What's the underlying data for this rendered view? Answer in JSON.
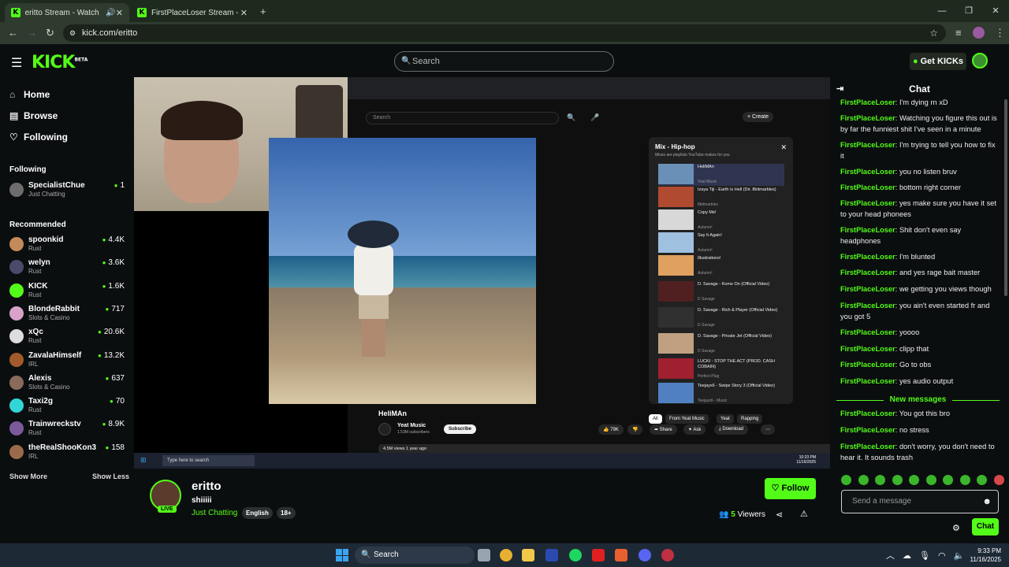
{
  "browser": {
    "tabs": [
      {
        "label": "eritto Stream - Watch Live o",
        "active": true
      },
      {
        "label": "FirstPlaceLoser Stream - Watch",
        "active": false
      }
    ],
    "url": "kick.com/eritto"
  },
  "header": {
    "logo": "KICK",
    "logo_beta": "BETA",
    "search_placeholder": "Search",
    "get_kicks": "Get KICKs"
  },
  "sidebar": {
    "nav": [
      {
        "label": "Home",
        "icon": "home-icon"
      },
      {
        "label": "Browse",
        "icon": "browse-icon"
      },
      {
        "label": "Following",
        "icon": "heart-icon"
      }
    ],
    "following_heading": "Following",
    "following": [
      {
        "name": "SpecialistChue",
        "category": "Just Chatting",
        "viewers": "1",
        "color": "#6d6d6d"
      }
    ],
    "recommended_heading": "Recommended",
    "recommended": [
      {
        "name": "spoonkid",
        "category": "Rust",
        "viewers": "4.4K",
        "color": "#c58a5a"
      },
      {
        "name": "welyn",
        "category": "Rust",
        "viewers": "3.6K",
        "color": "#4a4a6a"
      },
      {
        "name": "KICK",
        "category": "Rust",
        "viewers": "1.6K",
        "color": "#53fc18"
      },
      {
        "name": "BlondeRabbit",
        "category": "Slots & Casino",
        "viewers": "717",
        "color": "#d9a3c9"
      },
      {
        "name": "xQc",
        "category": "Rust",
        "viewers": "20.6K",
        "color": "#dddddd"
      },
      {
        "name": "ZavalaHimself",
        "category": "IRL",
        "viewers": "13.2K",
        "color": "#a35a2a"
      },
      {
        "name": "Alexis",
        "category": "Slots & Casino",
        "viewers": "637",
        "color": "#8a6a5a"
      },
      {
        "name": "Taxi2g",
        "category": "Rust",
        "viewers": "70",
        "color": "#33d6d6"
      },
      {
        "name": "Trainwreckstv",
        "category": "Rust",
        "viewers": "8.9K",
        "color": "#7a5a9a"
      },
      {
        "name": "theRealShooKon3",
        "category": "IRL",
        "viewers": "158",
        "color": "#9a6a4a"
      }
    ],
    "show_more": "Show More",
    "show_less": "Show Less"
  },
  "stream_overlay": {
    "yt_search": "Search",
    "yt_create": "+ Create",
    "mix_title": "Mix - Hip-hop",
    "mix_sub": "Mixes are playlists YouTube makes for you",
    "mix_items": [
      {
        "title": "HeliMAn",
        "artist": "Yeat Music"
      },
      {
        "title": "Izaya Tiji - Earth Is Hell (Dir. 8bitmarbles)",
        "artist": "8bitmarbles"
      },
      {
        "title": "Copy Me!",
        "artist": "Autumn!"
      },
      {
        "title": "Say It Again!",
        "artist": "Autumn!"
      },
      {
        "title": "Illustrations!",
        "artist": "Autumn!"
      },
      {
        "title": "D. Savage - Kome On (Official Video)",
        "artist": "D Savage"
      },
      {
        "title": "D. Savage - Rich & Player (Official Video)",
        "artist": "D Savage"
      },
      {
        "title": "D. Savage - Private Jet (Official Video)",
        "artist": "D Savage"
      },
      {
        "title": "LUCKI - STOP THE ACT (PROD. CASH COBAIN)",
        "artist": "Perfect Plug"
      },
      {
        "title": "Teejayx6 - Swipe Story 3 (Official Video)",
        "artist": "Teejayx6 - Music"
      }
    ],
    "video_title": "HeliMAn",
    "channel": "Yeat Music",
    "subscribers": "1.53M subscribers",
    "subscribe": "Subscribe",
    "likes": "79K",
    "share": "Share",
    "ask": "Ask",
    "download": "Download",
    "views_line": "4.5M views  1 year ago",
    "chips": [
      "All",
      "From Yeat Music",
      "Yeat",
      "Rapping"
    ],
    "win_search": "Type here to search",
    "win_time": "10:33 PM",
    "win_date": "11/16/2025"
  },
  "channel_info": {
    "username": "eritto",
    "live": "LIVE",
    "title": "shiiiii",
    "category": "Just Chatting",
    "tags": [
      "English",
      "18+"
    ],
    "follow": "Follow",
    "viewers_count": "5",
    "viewers_label": "Viewers"
  },
  "chat": {
    "heading": "Chat",
    "messages": [
      {
        "user": "FirstPlaceLoser",
        "text": "I'm dying rn xD"
      },
      {
        "user": "FirstPlaceLoser",
        "text": "Watching you figure this out is by far the funniest shit I've seen in a minute"
      },
      {
        "user": "FirstPlaceLoser",
        "text": "I'm trying to tell you how to fix it"
      },
      {
        "user": "FirstPlaceLoser",
        "text": "you no listen bruv"
      },
      {
        "user": "FirstPlaceLoser",
        "text": "bottom right corner"
      },
      {
        "user": "FirstPlaceLoser",
        "text": "yes make sure you have it set to your head phonees"
      },
      {
        "user": "FirstPlaceLoser",
        "text": "Shit don't even say headphones"
      },
      {
        "user": "FirstPlaceLoser",
        "text": "I'm blunted"
      },
      {
        "user": "FirstPlaceLoser",
        "text": "and yes rage bait master"
      },
      {
        "user": "FirstPlaceLoser",
        "text": "we getting you views though"
      },
      {
        "user": "FirstPlaceLoser",
        "text": "you ain't even started fr and you got 5"
      },
      {
        "user": "FirstPlaceLoser",
        "text": "yoooo"
      },
      {
        "user": "FirstPlaceLoser",
        "text": "clipp that"
      },
      {
        "user": "FirstPlaceLoser",
        "text": "Go to obs"
      },
      {
        "user": "FirstPlaceLoser",
        "text": "yes audio output"
      }
    ],
    "new_messages_label": "New messages",
    "new_messages": [
      {
        "user": "FirstPlaceLoser",
        "text": "You got this bro"
      },
      {
        "user": "FirstPlaceLoser",
        "text": "no stress"
      },
      {
        "user": "FirstPlaceLoser",
        "text": "don't worry, you don't need to hear it. It sounds trash"
      }
    ],
    "input_placeholder": "Send a message",
    "send": "Chat"
  },
  "taskbar": {
    "search": "Search",
    "time": "9:33 PM",
    "date": "11/16/2025"
  },
  "colors": {
    "accent": "#53fc18",
    "background": "#0b0e0f"
  }
}
